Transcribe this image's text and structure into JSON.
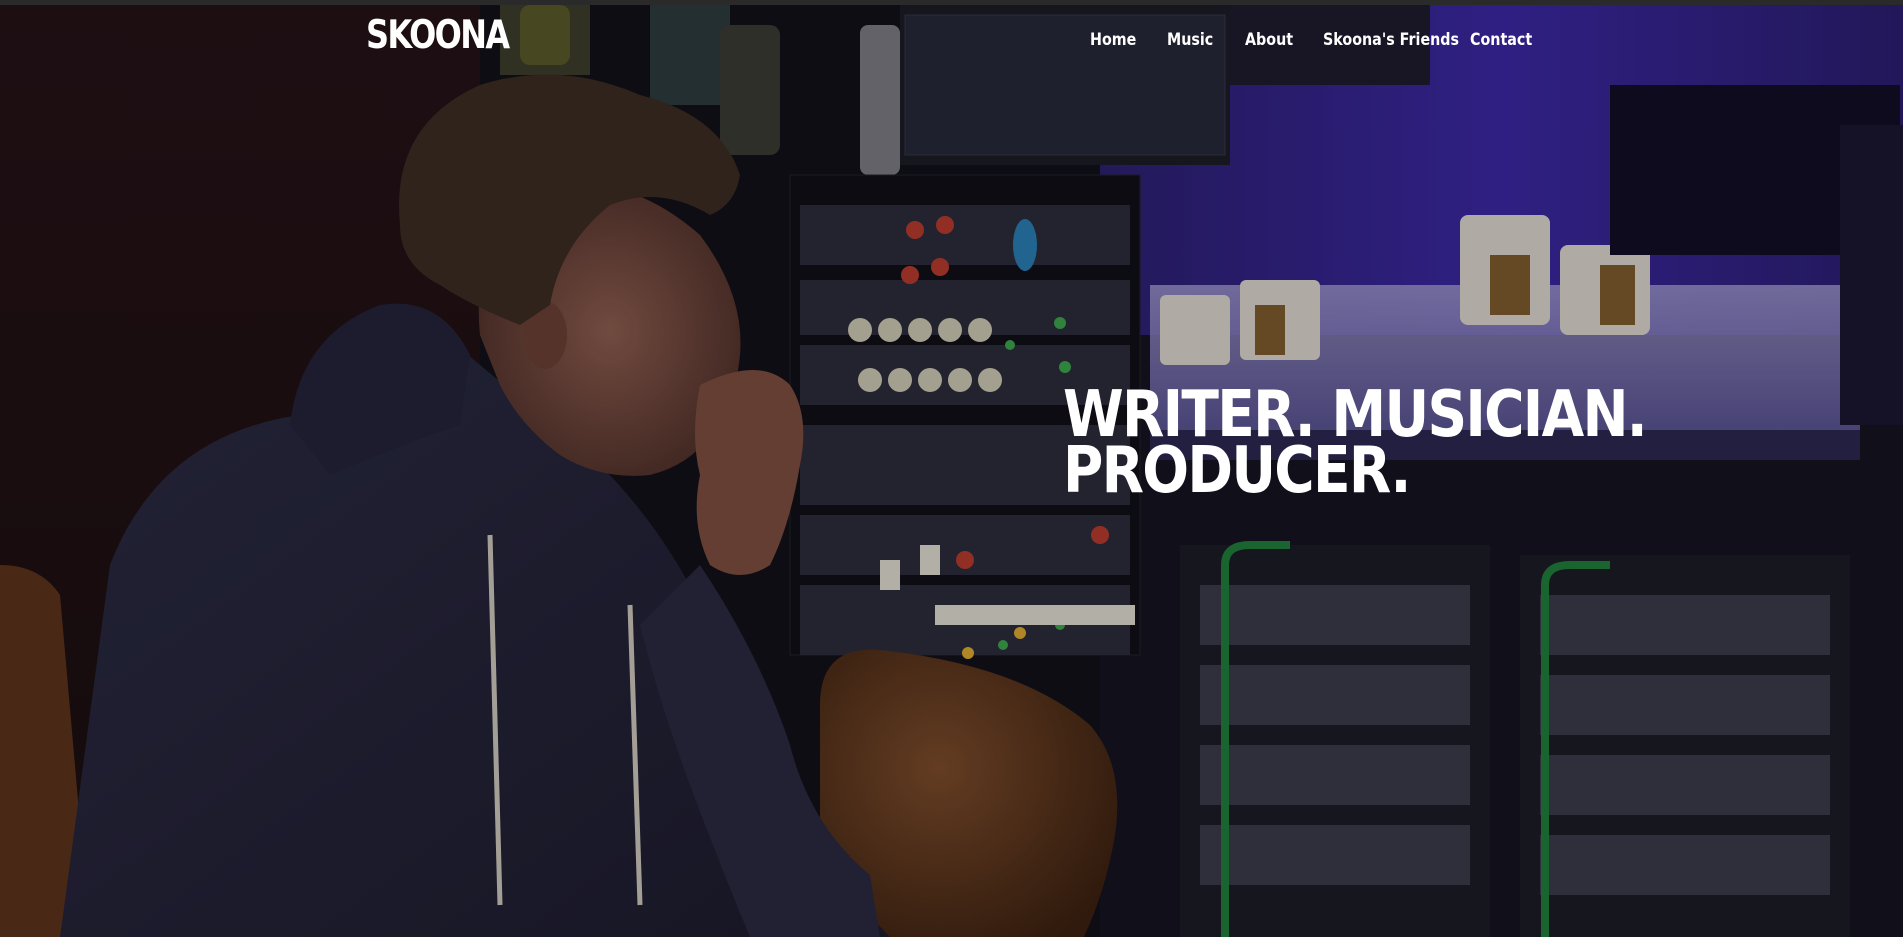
{
  "brand": {
    "name": "SKOONA"
  },
  "nav": {
    "items": [
      {
        "label": "Home"
      },
      {
        "label": "Music"
      },
      {
        "label": "About"
      },
      {
        "label": "Skoona's Friends"
      },
      {
        "label": "Contact"
      }
    ]
  },
  "hero": {
    "headline_line1": "WRITER. MUSICIAN.",
    "headline_line2": "PRODUCER.",
    "image": "studio-portrait-photo"
  },
  "colors": {
    "text": "#ffffff",
    "studio_purple": "#3a2a9a",
    "leather_brown": "#6b3f22"
  }
}
